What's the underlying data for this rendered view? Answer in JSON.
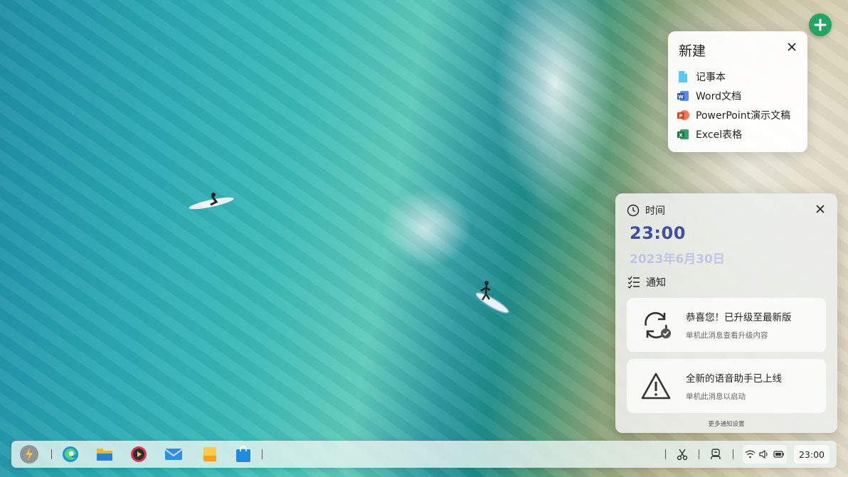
{
  "new_menu": {
    "title": "新建",
    "items": [
      {
        "label": "记事本",
        "icon": "notepad-icon",
        "color": "#4fc3f7"
      },
      {
        "label": "Word文档",
        "icon": "word-icon",
        "color": "#2b579a"
      },
      {
        "label": "PowerPoint演示文稿",
        "icon": "powerpoint-icon",
        "color": "#d24726"
      },
      {
        "label": "Excel表格",
        "icon": "excel-icon",
        "color": "#217346"
      }
    ]
  },
  "time_panel": {
    "header": "时间",
    "time": "23:00",
    "date": "2023年6月30日"
  },
  "notify_panel": {
    "header": "通知",
    "items": [
      {
        "title": "恭喜您！已升级至最新版",
        "subtitle": "单机此消息查看升级内容",
        "icon": "update-sync-icon"
      },
      {
        "title": "全新的语音助手已上线",
        "subtitle": "单机此消息以启动",
        "icon": "warning-icon"
      }
    ],
    "more_settings": "更多通知设置"
  },
  "taskbar": {
    "apps": [
      "launcher-icon",
      "edge-browser-icon",
      "file-manager-icon",
      "media-player-icon",
      "mail-icon",
      "notes-icon",
      "store-icon"
    ],
    "tray_icons": [
      "screenshot-icon",
      "assistant-icon",
      "wifi-icon",
      "volume-icon",
      "battery-icon"
    ],
    "time": "23:00"
  },
  "colors": {
    "accent_green": "#23a564",
    "time_blue": "#3f4fa0"
  }
}
